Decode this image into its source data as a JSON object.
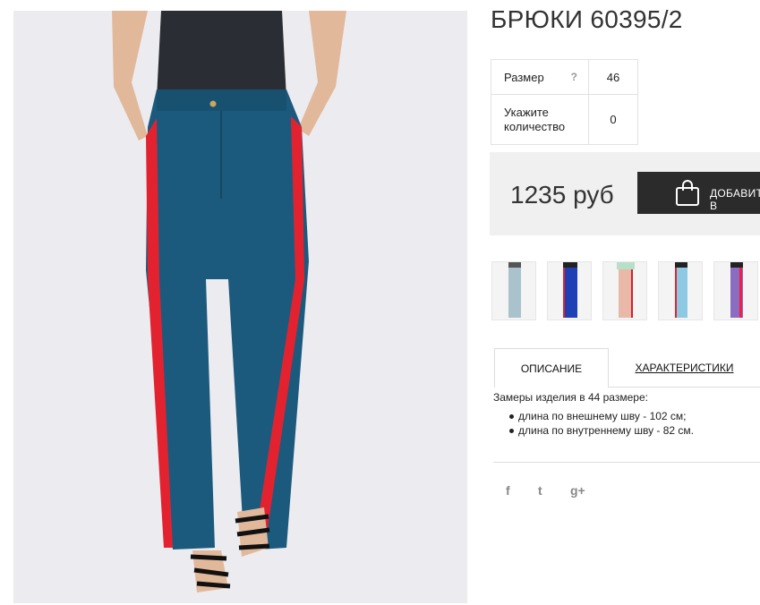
{
  "product": {
    "title": "БРЮКИ 60395/2",
    "photo_alt": "product-photo"
  },
  "options": {
    "size_label": "Размер",
    "size_help": "?",
    "size_value": "46",
    "qty_label": "Укажите количество",
    "qty_value": "0"
  },
  "purchase": {
    "price": "1235 руб",
    "cart_label": "ДОБАВИТЬ В КОРЗИНУ",
    "cart_icon": "shopping-bag-icon"
  },
  "colors": {
    "thumb_colors": [
      "#a9c2cc",
      "#1f3fb4",
      "#eab8a8",
      "#8ec9e3",
      "#8a6cc0"
    ],
    "stripe": "#e2232f",
    "main_pants": "#1c5a7d",
    "button_bg": "#2b2b2b"
  },
  "tabs": {
    "description": "ОПИСАНИЕ",
    "characteristics": "ХАРАКТЕРИСТИКИ"
  },
  "description": {
    "lead": "Замеры изделия в 44 размере:",
    "items": [
      "длина по внешнему шву - 102 см;",
      "длина по внутреннему шву - 82 см."
    ]
  },
  "social": {
    "facebook": "f",
    "twitter": "t",
    "googleplus": "g+"
  }
}
